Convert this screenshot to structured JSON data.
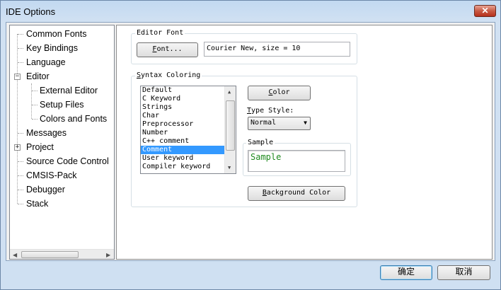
{
  "window": {
    "title": "IDE Options",
    "close_glyph": "✕"
  },
  "tree": {
    "items": [
      {
        "label": "Common Fonts"
      },
      {
        "label": "Key Bindings"
      },
      {
        "label": "Language"
      },
      {
        "label": "Editor",
        "expander": "−"
      },
      {
        "label": "External Editor"
      },
      {
        "label": "Setup Files"
      },
      {
        "label": "Colors and Fonts"
      },
      {
        "label": "Messages"
      },
      {
        "label": "Project",
        "expander": "+"
      },
      {
        "label": "Source Code Control"
      },
      {
        "label": "CMSIS-Pack"
      },
      {
        "label": "Debugger"
      },
      {
        "label": "Stack"
      }
    ]
  },
  "editor_font": {
    "group_label": "Editor Font",
    "button_label_underline": "F",
    "button_label_rest": "ont...",
    "value": "Courier New, size = 10"
  },
  "syntax": {
    "group_label_underline": "S",
    "group_label_rest": "yntax Coloring",
    "items": [
      "Default",
      "C Keyword",
      "Strings",
      "Char",
      "Preprocessor",
      "Number",
      "C++ comment",
      "Comment",
      "User keyword",
      "Compiler keyword"
    ],
    "selected": "Comment",
    "color_button_underline": "C",
    "color_button_rest": "olor",
    "type_style_underline": "T",
    "type_style_rest": "ype Style:",
    "type_style_value": "Normal",
    "sample_label": "Sample",
    "sample_text": "Sample",
    "sample_color": "#1f8a1f",
    "background_button_underline": "B",
    "background_button_rest": "ackground Color"
  },
  "footer": {
    "ok_label": "确定",
    "cancel_label": "取消"
  }
}
